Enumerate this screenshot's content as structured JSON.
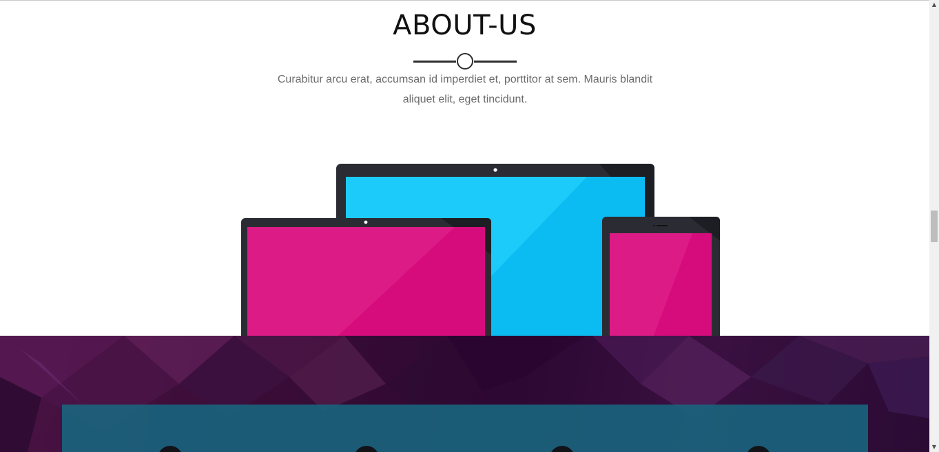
{
  "about": {
    "title": "ABOUT-US",
    "description": "Curabitur arcu erat, accumsan id imperdiet et, porttitor at sem. Mauris blandit aliquet elit, eget tincidunt."
  },
  "colors": {
    "screen_blue": "#1ccbf9",
    "screen_pink": "#dd1b86",
    "device_frame": "#2b2c33",
    "dark_section": "#3b0d37",
    "teal_panel": "#186680"
  },
  "features": {
    "icons": [
      "feature-icon-1",
      "feature-icon-2",
      "feature-icon-3",
      "feature-icon-4"
    ]
  },
  "scrollbar": {
    "up_arrow": "▲",
    "down_arrow": "▼"
  }
}
